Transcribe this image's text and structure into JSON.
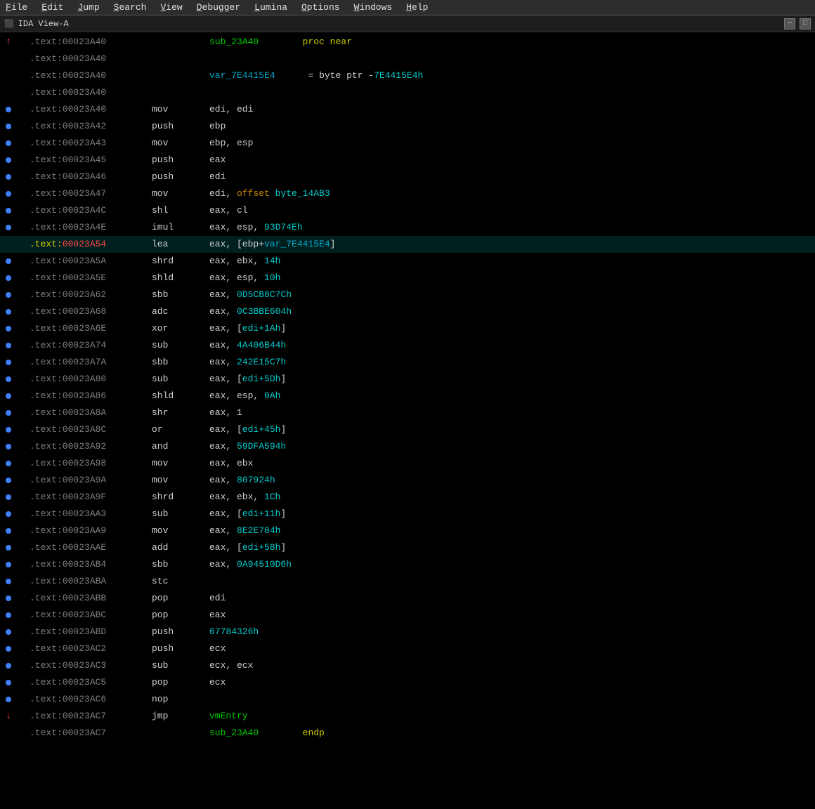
{
  "menubar": {
    "items": [
      {
        "label": "File",
        "underline": "F"
      },
      {
        "label": "Edit",
        "underline": "E"
      },
      {
        "label": "Jump",
        "underline": "J"
      },
      {
        "label": "Search",
        "underline": "S"
      },
      {
        "label": "View",
        "underline": "V"
      },
      {
        "label": "Debugger",
        "underline": "D"
      },
      {
        "label": "Lumina",
        "underline": "L"
      },
      {
        "label": "Options",
        "underline": "O"
      },
      {
        "label": "Windows",
        "underline": "W"
      },
      {
        "label": "Help",
        "underline": "H"
      }
    ]
  },
  "titlebar": {
    "icon": "IDA",
    "title": "IDA View-A"
  },
  "lines": [
    {
      "addr": ".text:00023A40",
      "addr_class": "normal",
      "bullet": false,
      "arrow": "up-red",
      "func": "sub_23A40",
      "suffix": " proc near",
      "type": "proc"
    },
    {
      "addr": ".text:00023A40",
      "addr_class": "normal",
      "bullet": false,
      "arrow": false,
      "type": "blank"
    },
    {
      "addr": ".text:00023A40",
      "addr_class": "normal",
      "bullet": false,
      "arrow": false,
      "var": "var_7E4415E4",
      "assign": "= byte ptr -7E4415E4h",
      "type": "var"
    },
    {
      "addr": ".text:00023A40",
      "addr_class": "normal",
      "bullet": false,
      "arrow": false,
      "type": "blank2"
    },
    {
      "addr": ".text:00023A40",
      "addr_class": "normal",
      "bullet": true,
      "arrow": false,
      "mnemonic": "mov",
      "operands": "edi, edi"
    },
    {
      "addr": ".text:00023A42",
      "addr_class": "normal",
      "bullet": true,
      "arrow": false,
      "mnemonic": "push",
      "operands": "ebp"
    },
    {
      "addr": ".text:00023A43",
      "addr_class": "normal",
      "bullet": true,
      "arrow": false,
      "mnemonic": "mov",
      "operands": "ebp, esp"
    },
    {
      "addr": ".text:00023A45",
      "addr_class": "normal",
      "bullet": true,
      "arrow": false,
      "mnemonic": "push",
      "operands": "eax"
    },
    {
      "addr": ".text:00023A46",
      "addr_class": "normal",
      "bullet": true,
      "arrow": false,
      "mnemonic": "push",
      "operands": "edi"
    },
    {
      "addr": ".text:00023A47",
      "addr_class": "normal",
      "bullet": true,
      "arrow": false,
      "mnemonic": "mov",
      "operands": "edi, offset byte_14AB3"
    },
    {
      "addr": ".text:00023A4C",
      "addr_class": "normal",
      "bullet": true,
      "arrow": false,
      "mnemonic": "shl",
      "operands": "eax, cl"
    },
    {
      "addr": ".text:00023A4E",
      "addr_class": "normal",
      "bullet": true,
      "arrow": false,
      "mnemonic": "imul",
      "operands": "eax, esp, 93D74Eh"
    },
    {
      "addr": ".text:00023A54",
      "addr_class": "highlight",
      "bullet": false,
      "arrow": false,
      "mnemonic": "lea",
      "operands": "eax, [ebp+var_7E4415E4]"
    },
    {
      "addr": ".text:00023A5A",
      "addr_class": "normal",
      "bullet": true,
      "arrow": false,
      "mnemonic": "shrd",
      "operands": "eax, ebx, 14h"
    },
    {
      "addr": ".text:00023A5E",
      "addr_class": "normal",
      "bullet": true,
      "arrow": false,
      "mnemonic": "shld",
      "operands": "eax, esp, 10h"
    },
    {
      "addr": ".text:00023A62",
      "addr_class": "normal",
      "bullet": true,
      "arrow": false,
      "mnemonic": "sbb",
      "operands": "eax, 0D5CB8C7Ch"
    },
    {
      "addr": ".text:00023A68",
      "addr_class": "normal",
      "bullet": true,
      "arrow": false,
      "mnemonic": "adc",
      "operands": "eax, 0C3BBE604h"
    },
    {
      "addr": ".text:00023A6E",
      "addr_class": "normal",
      "bullet": true,
      "arrow": false,
      "mnemonic": "xor",
      "operands": "eax, [edi+1Ah]"
    },
    {
      "addr": ".text:00023A74",
      "addr_class": "normal",
      "bullet": true,
      "arrow": false,
      "mnemonic": "sub",
      "operands": "eax, 4A406B44h"
    },
    {
      "addr": ".text:00023A7A",
      "addr_class": "normal",
      "bullet": true,
      "arrow": false,
      "mnemonic": "sbb",
      "operands": "eax, 242E15C7h"
    },
    {
      "addr": ".text:00023A80",
      "addr_class": "normal",
      "bullet": true,
      "arrow": false,
      "mnemonic": "sub",
      "operands": "eax, [edi+5Dh]"
    },
    {
      "addr": ".text:00023A86",
      "addr_class": "normal",
      "bullet": true,
      "arrow": false,
      "mnemonic": "shld",
      "operands": "eax, esp, 0Ah"
    },
    {
      "addr": ".text:00023A8A",
      "addr_class": "normal",
      "bullet": true,
      "arrow": false,
      "mnemonic": "shr",
      "operands": "eax, 1"
    },
    {
      "addr": ".text:00023A8C",
      "addr_class": "normal",
      "bullet": true,
      "arrow": false,
      "mnemonic": "or",
      "operands": "eax, [edi+45h]"
    },
    {
      "addr": ".text:00023A92",
      "addr_class": "normal",
      "bullet": true,
      "arrow": false,
      "mnemonic": "and",
      "operands": "eax, 59DFA594h"
    },
    {
      "addr": ".text:00023A98",
      "addr_class": "normal",
      "bullet": true,
      "arrow": false,
      "mnemonic": "mov",
      "operands": "eax, ebx"
    },
    {
      "addr": ".text:00023A9A",
      "addr_class": "normal",
      "bullet": true,
      "arrow": false,
      "mnemonic": "mov",
      "operands": "eax, 807924h"
    },
    {
      "addr": ".text:00023A9F",
      "addr_class": "normal",
      "bullet": true,
      "arrow": false,
      "mnemonic": "shrd",
      "operands": "eax, ebx, 1Ch"
    },
    {
      "addr": ".text:00023AA3",
      "addr_class": "normal",
      "bullet": true,
      "arrow": false,
      "mnemonic": "sub",
      "operands": "eax, [edi+11h]"
    },
    {
      "addr": ".text:00023AA9",
      "addr_class": "normal",
      "bullet": true,
      "arrow": false,
      "mnemonic": "mov",
      "operands": "eax, 8E2E704h"
    },
    {
      "addr": ".text:00023AAE",
      "addr_class": "normal",
      "bullet": true,
      "arrow": false,
      "mnemonic": "add",
      "operands": "eax, [edi+58h]"
    },
    {
      "addr": ".text:00023AB4",
      "addr_class": "normal",
      "bullet": true,
      "arrow": false,
      "mnemonic": "sbb",
      "operands": "eax, 0A94510D6h"
    },
    {
      "addr": ".text:00023ABA",
      "addr_class": "normal",
      "bullet": true,
      "arrow": false,
      "mnemonic": "stc",
      "operands": ""
    },
    {
      "addr": ".text:00023ABB",
      "addr_class": "normal",
      "bullet": true,
      "arrow": false,
      "mnemonic": "pop",
      "operands": "edi"
    },
    {
      "addr": ".text:00023ABC",
      "addr_class": "normal",
      "bullet": true,
      "arrow": false,
      "mnemonic": "pop",
      "operands": "eax"
    },
    {
      "addr": ".text:00023ABD",
      "addr_class": "normal",
      "bullet": true,
      "arrow": false,
      "mnemonic": "push",
      "operands": "67784326h"
    },
    {
      "addr": ".text:00023AC2",
      "addr_class": "normal",
      "bullet": true,
      "arrow": false,
      "mnemonic": "push",
      "operands": "ecx"
    },
    {
      "addr": ".text:00023AC3",
      "addr_class": "normal",
      "bullet": true,
      "arrow": false,
      "mnemonic": "sub",
      "operands": "ecx, ecx"
    },
    {
      "addr": ".text:00023AC5",
      "addr_class": "normal",
      "bullet": true,
      "arrow": false,
      "mnemonic": "pop",
      "operands": "ecx"
    },
    {
      "addr": ".text:00023AC6",
      "addr_class": "normal",
      "bullet": true,
      "arrow": false,
      "mnemonic": "nop",
      "operands": ""
    },
    {
      "addr": ".text:00023AC7",
      "addr_class": "normal",
      "bullet": false,
      "arrow": "down-red",
      "mnemonic": "jmp",
      "operands": "vmEntry"
    },
    {
      "addr": ".text:00023AC7",
      "addr_class": "normal",
      "bullet": false,
      "arrow": false,
      "func": "sub_23A40",
      "type": "endp"
    }
  ]
}
